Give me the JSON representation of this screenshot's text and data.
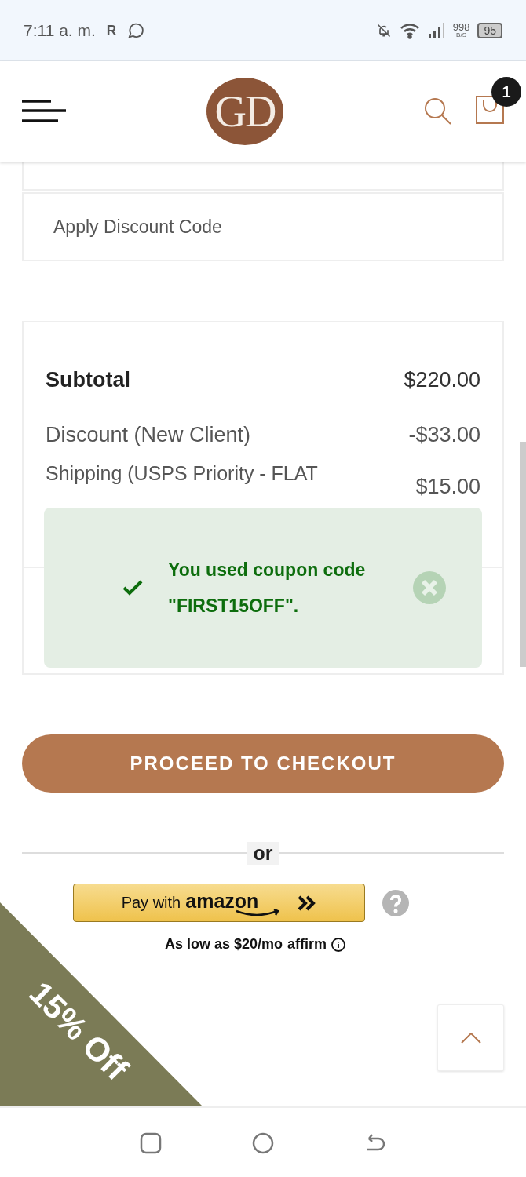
{
  "status_bar": {
    "time": "7:11 a. m.",
    "carrier_mark": "R",
    "speed": "998",
    "speed_unit": "B/S",
    "battery": "95"
  },
  "header": {
    "logo": "GD",
    "cart_count": "1"
  },
  "discount": {
    "label": "Apply Discount Code"
  },
  "totals": [
    {
      "label": "Subtotal",
      "value": "$220.00",
      "kind": "bold"
    },
    {
      "label": "Discount (New Client)",
      "value": "-$33.00",
      "kind": "normal"
    },
    {
      "label": "Shipping (USPS Priority - FLAT",
      "value": "$15.00",
      "kind": "small"
    }
  ],
  "toast": {
    "message": "You used coupon code \"FIRST15OFF\"."
  },
  "checkout_button": "PROCEED TO CHECKOUT",
  "separator": "or",
  "amazon": {
    "prefix": "Pay with",
    "brand": "amazon"
  },
  "affirm": {
    "text": "As low as $20/mo",
    "brand": "affirm"
  },
  "promo": "15% Off"
}
